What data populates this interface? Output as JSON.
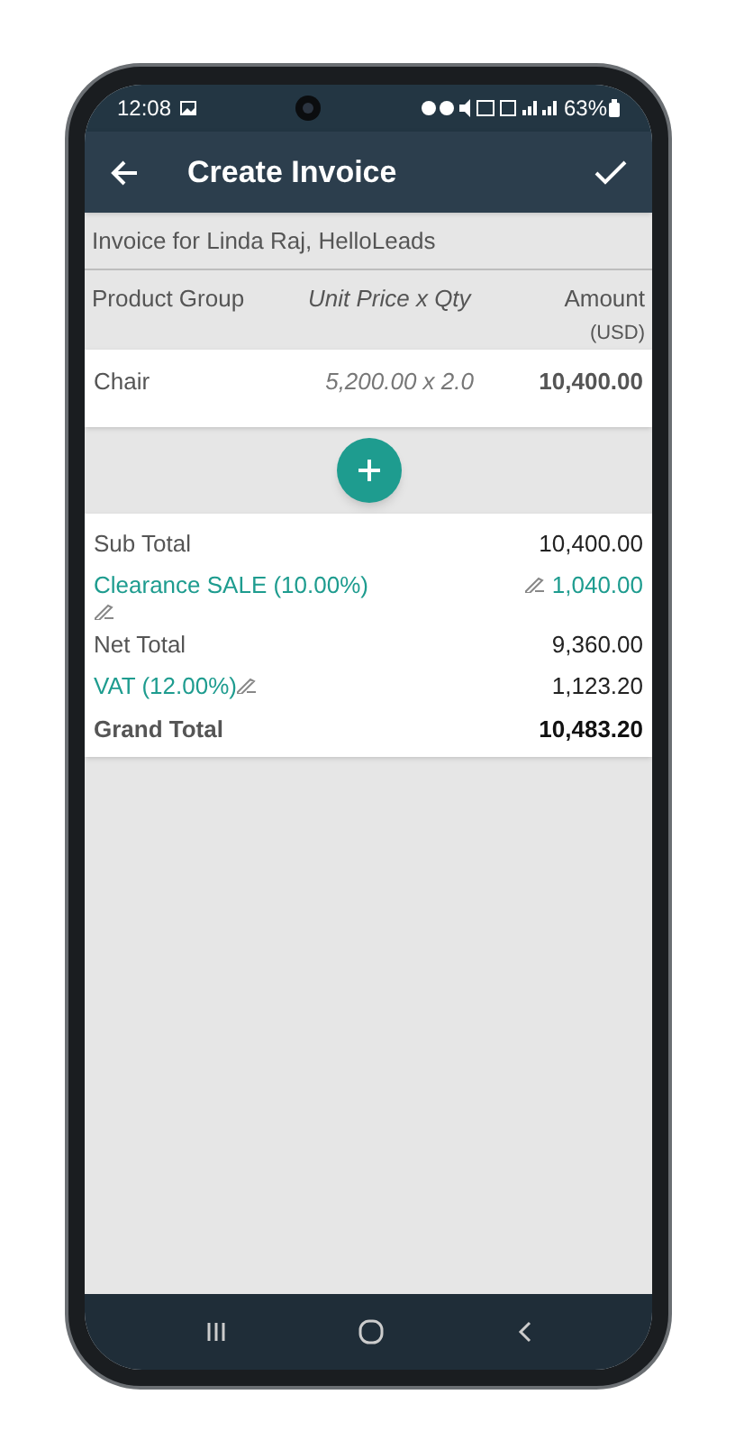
{
  "status_bar": {
    "time": "12:08",
    "battery": "63%"
  },
  "app_bar": {
    "title": "Create Invoice"
  },
  "subtitle": "Invoice for Linda Raj, HelloLeads",
  "columns": [
    {
      "label": "Product Group"
    },
    {
      "label": "Unit Price x Qty"
    },
    {
      "label": "Amount",
      "unit": "(USD)"
    }
  ],
  "items": [
    {
      "name": "Chair",
      "price_qty": "5,200.00 x 2.0",
      "amount": "10,400.00"
    }
  ],
  "totals": [
    {
      "kind": "line",
      "label": "Sub Total",
      "value": "10,400.00"
    },
    {
      "kind": "discount",
      "label": "Clearance SALE (10.00%)",
      "value": "1,040.00"
    },
    {
      "kind": "line",
      "label": "Net Total",
      "value": "9,360.00"
    },
    {
      "kind": "tax",
      "label": "VAT (12.00%)",
      "value": "1,123.20"
    },
    {
      "kind": "total",
      "label": "Grand Total",
      "value": "10,483.20"
    }
  ]
}
